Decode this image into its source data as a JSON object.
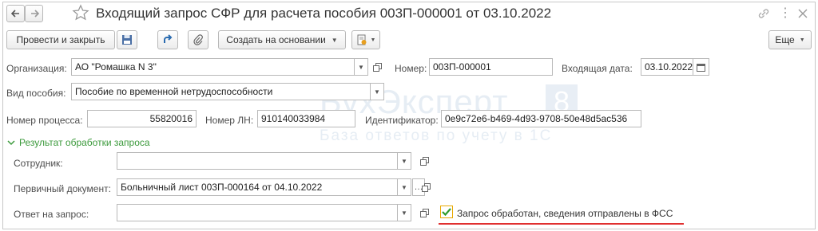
{
  "window": {
    "title": "Входящий запрос СФР для расчета пособия 003П-000001 от 03.10.2022",
    "icons": [
      "back-arrow-icon",
      "forward-arrow-icon",
      "star-icon",
      "link-icon",
      "more-icon",
      "close-icon"
    ]
  },
  "toolbar": {
    "post_close_label": "Провести и закрыть",
    "create_based_label": "Создать на основании",
    "more_label": "Еще",
    "icons": [
      "save-icon",
      "post-icon",
      "paperclip-icon",
      "report-icon"
    ]
  },
  "watermark": {
    "brand": "БухЭксперт",
    "digit": "8",
    "tagline": "База ответов по учету в 1С"
  },
  "form": {
    "organization_label": "Организация:",
    "organization_value": "АО \"Ромашка N 3\"",
    "number_label": "Номер:",
    "number_value": "003П-000001",
    "incoming_date_label": "Входящая дата:",
    "incoming_date_value": "03.10.2022",
    "benefit_type_label": "Вид пособия:",
    "benefit_type_value": "Пособие по временной нетрудоспособности",
    "process_number_label": "Номер процесса:",
    "process_number_value": "55820016",
    "ln_number_label": "Номер ЛН:",
    "ln_number_value": "910140033984",
    "identifier_label": "Идентификатор:",
    "identifier_value": "0e9c72e6-b469-4d93-9708-50e48d5ac536"
  },
  "result_section": {
    "title": "Результат обработки запроса",
    "employee_label": "Сотрудник:",
    "employee_value": "",
    "primary_doc_label": "Первичный документ:",
    "primary_doc_value": "Больничный лист 003П-000164 от 04.10.2022",
    "response_label": "Ответ на запрос:",
    "response_value": "",
    "processed_checkbox_label": "Запрос обработан, сведения отправлены в ФСС",
    "processed_checked": true
  },
  "colors": {
    "accent_green": "#3c9a3c",
    "highlight_red": "#e03030",
    "checkbox_border": "#e8a800"
  }
}
